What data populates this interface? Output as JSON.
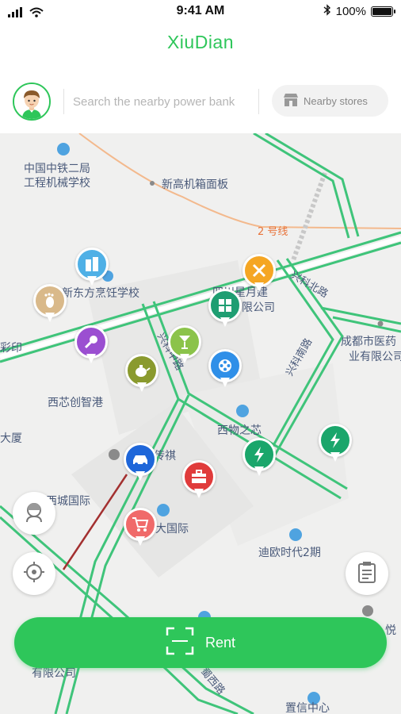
{
  "status_bar": {
    "time": "9:41 AM",
    "battery": "100%"
  },
  "app": {
    "title": "XiuDian"
  },
  "search": {
    "placeholder": "Search the nearby power bank"
  },
  "nearby_button": {
    "label": "Nearby stores"
  },
  "map_labels": {
    "school_1a": "中国中铁二局",
    "school_1b": "工程机械学校",
    "xingao": "新高机箱面板",
    "line2": "2 号线",
    "cooking_school": "新东方烹饪学校",
    "company_a": "四川星月建",
    "company_b": "限公司",
    "xinke_north": "兴科北路",
    "xinke_middle": "兴科中路",
    "xinke_south": "兴科南路",
    "yingyin": "彩印",
    "chengdu_a": "成都市医药",
    "chengdu_b": "业有限公司",
    "xixin": "西芯创智港",
    "xiwu": "西物之芯",
    "dasha": "大厦",
    "chuanqi": "传祺",
    "xicheng": "西城国际",
    "guoji": "大国际",
    "dioushidai": "迪欧时代2期",
    "youxian": "有限公司",
    "xilu": "蜀西路",
    "zhongxin": "置信中心",
    "yue": "悦"
  },
  "rent_button": {
    "label": "Rent"
  },
  "colors": {
    "accent": "#2ec65a",
    "road_green": "#3fc47a"
  },
  "pins": [
    {
      "name": "footprint-pin",
      "icon": "footprint-icon",
      "color": "#d9b98a"
    },
    {
      "name": "building-pin",
      "icon": "building-icon",
      "color": "#4fb0e6"
    },
    {
      "name": "karaoke-pin",
      "icon": "microphone-icon",
      "color": "#9b4fd1"
    },
    {
      "name": "tea-pin",
      "icon": "teapot-icon",
      "color": "#8a9a2e"
    },
    {
      "name": "drink-pin",
      "icon": "cocktail-icon",
      "color": "#8bc34a"
    },
    {
      "name": "food-pin",
      "icon": "fork-knife-icon",
      "color": "#f5a623"
    },
    {
      "name": "store-pin",
      "icon": "shop-grid-icon",
      "color": "#1e9e72"
    },
    {
      "name": "film-pin",
      "icon": "film-reel-icon",
      "color": "#2f8fe8"
    },
    {
      "name": "car-pin",
      "icon": "car-icon",
      "color": "#1e66d9"
    },
    {
      "name": "toolbox-pin",
      "icon": "toolbox-icon",
      "color": "#e03b3b"
    },
    {
      "name": "cart-pin",
      "icon": "cart-icon",
      "color": "#f06a6a"
    },
    {
      "name": "charge-pin-1",
      "icon": "lightning-icon",
      "color": "#1aa66b"
    },
    {
      "name": "charge-pin-2",
      "icon": "lightning-icon",
      "color": "#1aa66b"
    }
  ]
}
